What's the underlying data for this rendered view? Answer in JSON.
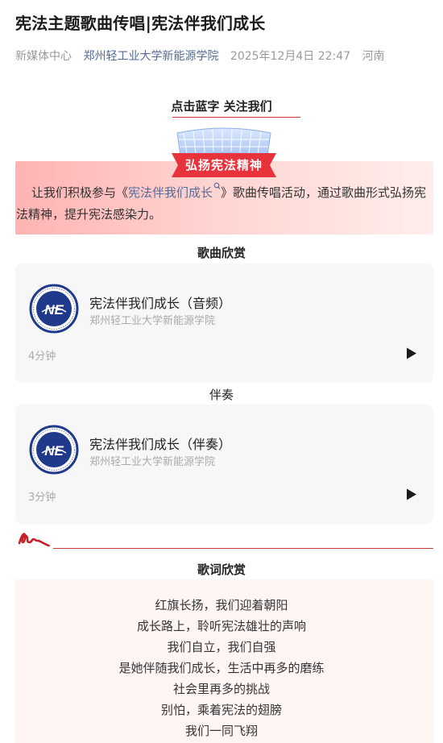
{
  "article": {
    "title": "宪法主题歌曲传唱|宪法伴我们成长",
    "author": "新媒体中心",
    "account": "郑州轻工业大学新能源学院",
    "date": "2025年12月4日 22:47",
    "location": "河南"
  },
  "follow": {
    "label": "点击蓝字 关注我们"
  },
  "banner": {
    "label": "弘扬宪法精神"
  },
  "intro": {
    "before": "让我们积极参与《",
    "link": "宪法伴我们成长",
    "after": "》歌曲传唱活动，通过歌曲形式弘扬宪法精神，提升宪法感染力。"
  },
  "sections": {
    "songs": "歌曲欣赏",
    "accompaniment": "伴奏",
    "lyrics": "歌词欣赏"
  },
  "audio_cards": [
    {
      "title": "宪法伴我们成长（音频）",
      "artist": "郑州轻工业大学新能源学院",
      "duration": "4分钟"
    },
    {
      "title": "宪法伴我们成长（伴奏）",
      "artist": "郑州轻工业大学新能源学院",
      "duration": "3分钟"
    }
  ],
  "logo": {
    "initials": "NE"
  },
  "lyrics": [
    "红旗长扬，我们迎着朝阳",
    "成长路上，聆听宪法雄壮的声响",
    "我们自立，我们自强",
    "是她伴随我们成长，生活中再多的磨练",
    "社会里再多的挑战",
    "别怕，乘着宪法的翅膀",
    "我们一同飞翔"
  ],
  "colors": {
    "accent_red": "#e8323c",
    "link_blue": "#576b95",
    "logo_navy": "#1f3a8a"
  },
  "icons": [
    "search-icon",
    "play-icon",
    "ribbon-flourish-icon"
  ]
}
